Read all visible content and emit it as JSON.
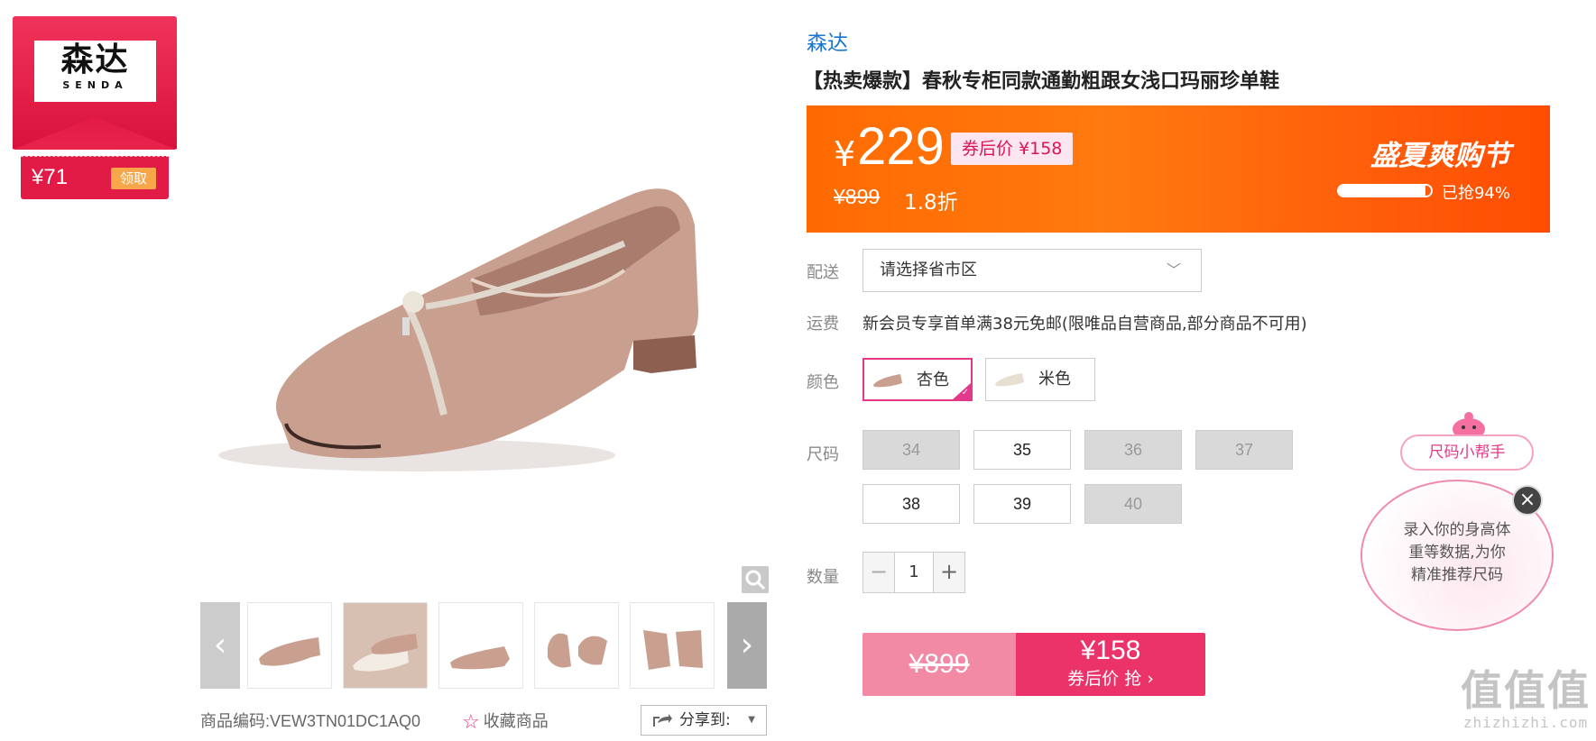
{
  "coupon": {
    "brand_cn": "森达",
    "brand_en": "SENDA",
    "amount": "¥71",
    "claim_label": "领取"
  },
  "gallery": {
    "thumb_count": 5,
    "prev_label": "‹",
    "next_label": "›"
  },
  "meta": {
    "sku_label": "商品编码:VEW3TN01DC1AQ0",
    "favorite_label": "收藏商品",
    "share_label": "分享到:"
  },
  "product": {
    "brand": "森达",
    "title": "【热卖爆款】春秋专柜同款通勤粗跟女浅口玛丽珍单鞋"
  },
  "price": {
    "currency": "¥",
    "current": "229",
    "after_coupon": "券后价 ¥158",
    "original": "¥899",
    "discount": "1.8折",
    "event": "盛夏爽购节",
    "sold_percent": 94,
    "sold_label": "已抢94%"
  },
  "delivery": {
    "label": "配送",
    "placeholder": "请选择省市区"
  },
  "freight": {
    "label": "运费",
    "text": "新会员专享首单满38元免邮(限唯品自营商品,部分商品不可用)"
  },
  "color": {
    "label": "颜色",
    "options": [
      {
        "name": "杏色",
        "selected": true
      },
      {
        "name": "米色",
        "selected": false
      }
    ]
  },
  "size": {
    "label": "尺码",
    "options": [
      {
        "value": "34",
        "available": false
      },
      {
        "value": "35",
        "available": true
      },
      {
        "value": "36",
        "available": false
      },
      {
        "value": "37",
        "available": false
      },
      {
        "value": "38",
        "available": true
      },
      {
        "value": "39",
        "available": true
      },
      {
        "value": "40",
        "available": false
      }
    ]
  },
  "quantity": {
    "label": "数量",
    "value": "1",
    "minus": "−",
    "plus": "+"
  },
  "buy": {
    "original": "¥899",
    "price": "¥158",
    "action": "券后价 抢 ›"
  },
  "size_helper": {
    "title": "尺码小帮手",
    "line1": "录入你的身高体",
    "line2": "重等数据,为你",
    "line3": "精准推荐尺码",
    "close": "×"
  },
  "watermark": {
    "big": "值值值",
    "small": "zhizhizhi.com"
  },
  "colors": {
    "accent_pink": "#e4388b",
    "price_orange": "#ff6a00",
    "buy_pink": "#eb336a",
    "brand_blue": "#1a75d2"
  }
}
